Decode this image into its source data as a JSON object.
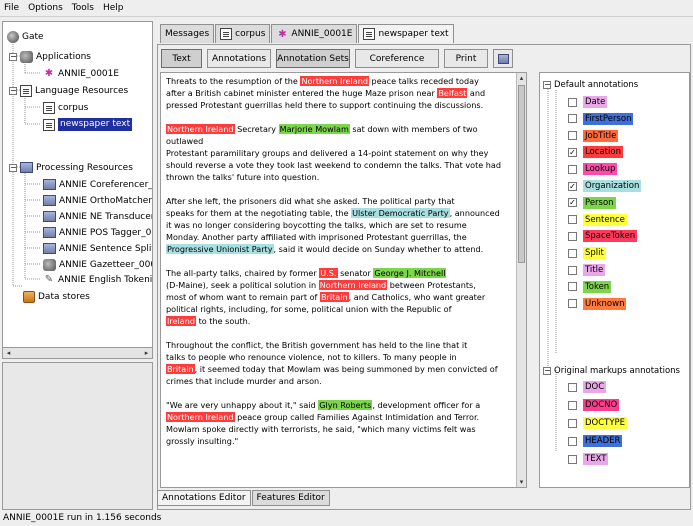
{
  "menu": [
    "File",
    "Options",
    "Tools",
    "Help"
  ],
  "tree": {
    "root": "Gate",
    "applications": "Applications",
    "app_items": [
      "ANNIE_0001E"
    ],
    "language_resources": "Language Resources",
    "lr_items": [
      "corpus",
      "newspaper text"
    ],
    "processing_resources": "Processing Resources",
    "pr_items": [
      "ANNIE Coreferencer_(",
      "ANNIE OrthoMatcher_",
      "ANNIE NE Transducer",
      "ANNIE POS Tagger_0",
      "ANNIE Sentence Split",
      "ANNIE Gazetteer_000",
      "ANNIE English Tokeni"
    ],
    "data_stores": "Data stores"
  },
  "doc_tabs": [
    "Messages",
    "corpus",
    "ANNIE_0001E",
    "newspaper text"
  ],
  "toolbar": {
    "text": "Text",
    "annotations": "Annotations",
    "annotation_sets": "Annotation Sets",
    "coreference": "Coreference",
    "print": "Print"
  },
  "text_paragraphs": [
    [
      [
        [
          "t",
          "Threats to the resumption of the "
        ],
        [
          "loc",
          "Northern Ireland"
        ],
        [
          "t",
          " peace talks receded today"
        ]
      ],
      [
        [
          "t",
          "after a British cabinet minister entered the huge Maze prison near "
        ],
        [
          "loc",
          "Belfast"
        ],
        [
          "t",
          " and"
        ]
      ],
      [
        [
          "t",
          "pressed Protestant guerrillas held there to support continuing the discussions."
        ]
      ]
    ],
    [
      [
        [
          "loc",
          "Northern Ireland"
        ],
        [
          "t",
          " Secretary "
        ],
        [
          "per",
          "Marjorie Mowlam"
        ],
        [
          "t",
          " sat down with members of two"
        ]
      ],
      [
        [
          "t",
          "outlawed"
        ]
      ],
      [
        [
          "t",
          "Protestant paramilitary groups and delivered a 14-point statement on why they"
        ]
      ],
      [
        [
          "t",
          "should reverse a vote they took last weekend to condemn the talks. That vote had"
        ]
      ],
      [
        [
          "t",
          "thrown the talks' future into question."
        ]
      ]
    ],
    [
      [
        [
          "t",
          "After she left, the prisoners did what she asked. The political party that"
        ]
      ],
      [
        [
          "t",
          "speaks for them at the negotiating table, the "
        ],
        [
          "org",
          "Ulster Democratic Party"
        ],
        [
          "t",
          ", announced"
        ]
      ],
      [
        [
          "t",
          "it was no longer considering boycotting the talks, which are set to resume"
        ]
      ],
      [
        [
          "t",
          "Monday. Another party affiliated with imprisoned Protestant guerrillas, the"
        ]
      ],
      [
        [
          "org",
          "Progressive Unionist Party"
        ],
        [
          "t",
          ", said it would decide on Sunday whether to attend."
        ]
      ]
    ],
    [
      [
        [
          "t",
          "The all-party talks, chaired by former "
        ],
        [
          "loc",
          "U.S."
        ],
        [
          "t",
          " senator "
        ],
        [
          "per",
          "George J. Mitchell"
        ]
      ],
      [
        [
          "t",
          "(D-Maine), seek a political solution in "
        ],
        [
          "loc",
          "Northern Ireland"
        ],
        [
          "t",
          " between Protestants,"
        ]
      ],
      [
        [
          "t",
          "most of whom want to remain part of "
        ],
        [
          "loc",
          "Britain"
        ],
        [
          "t",
          ", and Catholics, who want greater"
        ]
      ],
      [
        [
          "t",
          "political rights, including, for some, political union with the Republic of"
        ]
      ],
      [
        [
          "loc",
          "Ireland"
        ],
        [
          "t",
          " to the south."
        ]
      ]
    ],
    [
      [
        [
          "t",
          "Throughout the conflict, the British government has held to the line that it"
        ]
      ],
      [
        [
          "t",
          "talks to people who renounce violence, not to killers. To many people in"
        ]
      ],
      [
        [
          "loc",
          "Britain"
        ],
        [
          "t",
          ", it seemed today that Mowlam was being summoned by men convicted of"
        ]
      ],
      [
        [
          "t",
          "crimes that include murder and arson."
        ]
      ]
    ],
    [
      [
        [
          "t",
          "\"We are very unhappy about it,\" said "
        ],
        [
          "per",
          "Glyn Roberts"
        ],
        [
          "t",
          ", development officer for a"
        ]
      ],
      [
        [
          "loc",
          "Northern Ireland"
        ],
        [
          "t",
          " peace group called Families Against Intimidation and Terror."
        ]
      ],
      [
        [
          "t",
          "Mowlam spoke directly with terrorists, he said, \"which many victims felt was"
        ]
      ],
      [
        [
          "t",
          "grossly insulting.\""
        ]
      ]
    ]
  ],
  "annotation_sets": {
    "default_label": "Default annotations",
    "default_items": [
      {
        "name": "Date",
        "color": "#e8a8e8",
        "checked": false
      },
      {
        "name": "FirstPerson",
        "color": "#3f6fd8",
        "checked": false
      },
      {
        "name": "JobTitle",
        "color": "#ff6b3b",
        "checked": false
      },
      {
        "name": "Location",
        "color": "#ff3b3b",
        "checked": true
      },
      {
        "name": "Lookup",
        "color": "#ff4aa8",
        "checked": false
      },
      {
        "name": "Organization",
        "color": "#a8dfe0",
        "checked": true
      },
      {
        "name": "Person",
        "color": "#7cd54a",
        "checked": true
      },
      {
        "name": "Sentence",
        "color": "#ffff3b",
        "checked": false
      },
      {
        "name": "SpaceToken",
        "color": "#ff3b5b",
        "checked": false
      },
      {
        "name": "Split",
        "color": "#ffff3b",
        "checked": false
      },
      {
        "name": "Title",
        "color": "#e8a8e8",
        "checked": false
      },
      {
        "name": "Token",
        "color": "#7cd54a",
        "checked": false
      },
      {
        "name": "Unknown",
        "color": "#ff7b3b",
        "checked": false
      }
    ],
    "original_label": "Original markups annotations",
    "original_items": [
      {
        "name": "DOC",
        "color": "#e8a8e8",
        "checked": false
      },
      {
        "name": "DOCNO",
        "color": "#ff3b8b",
        "checked": false
      },
      {
        "name": "DOCTYPE",
        "color": "#ffff3b",
        "checked": false
      },
      {
        "name": "HEADER",
        "color": "#3f6fd8",
        "checked": false
      },
      {
        "name": "TEXT",
        "color": "#e8a8e8",
        "checked": false
      }
    ]
  },
  "bottom_tabs": [
    "Annotations Editor",
    "Features Editor"
  ],
  "status": "ANNIE_0001E run in 1.156 seconds"
}
